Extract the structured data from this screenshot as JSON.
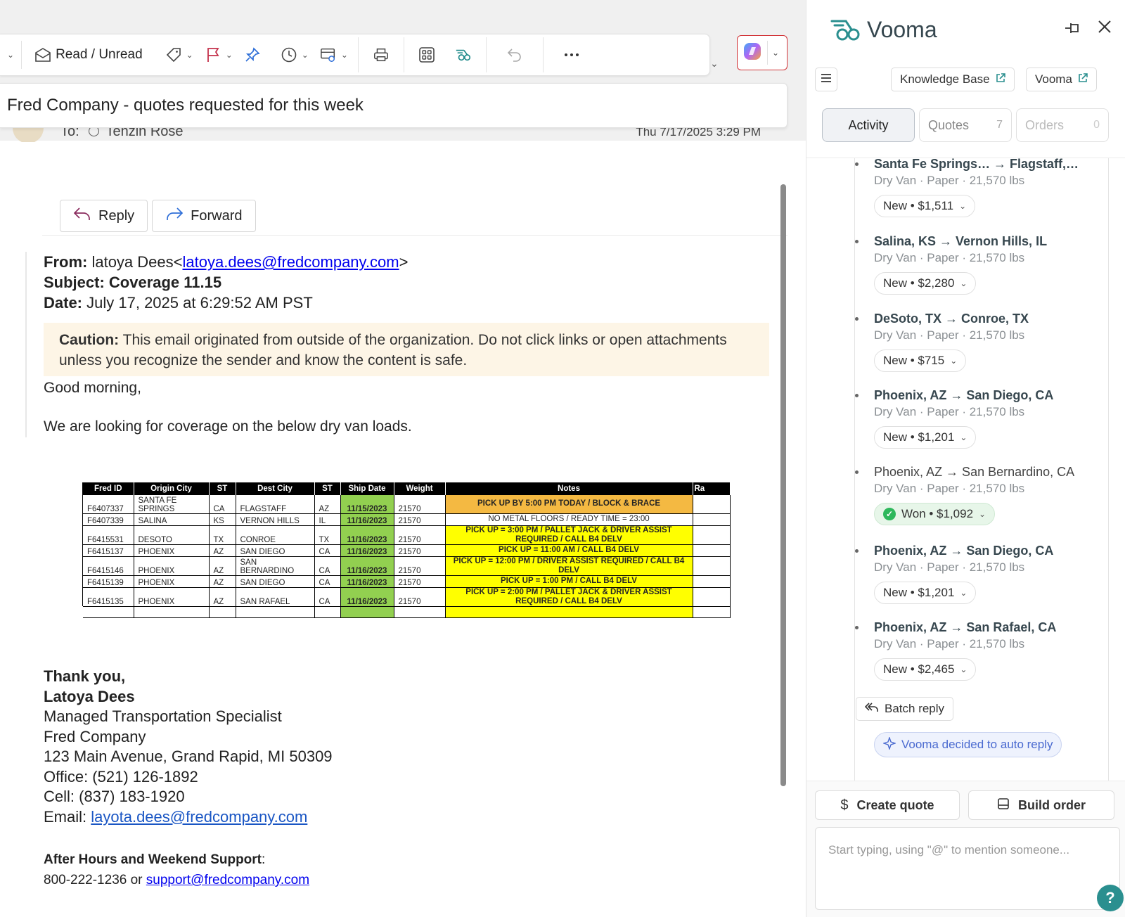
{
  "toolbar": {
    "read_unread_label": "Read / Unread"
  },
  "email": {
    "subject_bar": "Fred Company - quotes requested for this week",
    "to_prefix": "To:",
    "to_name": "Tenzin Rose",
    "date_received": "Thu 7/17/2025 3:29 PM",
    "reply_label": "Reply",
    "forward_label": "Forward",
    "from_label": "From:",
    "from_name": "latoya Dees",
    "from_email": "latoya.dees@fredcompany.com",
    "subject_line": "Subject: Coverage 11.15",
    "date_label": "Date:",
    "date_value": "July 17, 2025 at 6:29:52 AM PST",
    "caution_label": "Caution:",
    "caution_text": "This email originated from outside of the organization. Do not click links or open attachments unless you recognize the sender and know the content is safe.",
    "greeting": "Good morning,",
    "intro": "We are looking for coverage on the below dry van loads.",
    "table": {
      "headers": [
        "Fred ID",
        "Origin City",
        "ST",
        "Dest City",
        "ST",
        "Ship Date",
        "Weight",
        "Notes",
        "Ra"
      ],
      "rows": [
        {
          "id": "F6407337",
          "origin": "SANTA FE SPRINGS",
          "ost": "CA",
          "dest": "FLAGSTAFF",
          "dst": "AZ",
          "date": "11/15/2023",
          "weight": "21570",
          "notes": "PICK UP BY 5:00 PM TODAY / BLOCK & BRACE"
        },
        {
          "id": "F6407339",
          "origin": "SALINA",
          "ost": "KS",
          "dest": "VERNON HILLS",
          "dst": "IL",
          "date": "11/16/2023",
          "weight": "21570",
          "notes": "NO METAL FLOORS / READY TIME = 23:00"
        },
        {
          "id": "F6415531",
          "origin": "DESOTO",
          "ost": "TX",
          "dest": "CONROE",
          "dst": "TX",
          "date": "11/16/2023",
          "weight": "21570",
          "notes": "PICK UP = 3:00 PM / PALLET JACK & DRIVER ASSIST REQUIRED / CALL B4 DELV"
        },
        {
          "id": "F6415137",
          "origin": "PHOENIX",
          "ost": "AZ",
          "dest": "SAN DIEGO",
          "dst": "CA",
          "date": "11/16/2023",
          "weight": "21570",
          "notes": "PICK UP = 11:00 AM / CALL B4 DELV"
        },
        {
          "id": "F6415146",
          "origin": "PHOENIX",
          "ost": "AZ",
          "dest": "SAN BERNARDINO",
          "dst": "CA",
          "date": "11/16/2023",
          "weight": "21570",
          "notes": "PICK UP = 12:00 PM / DRIVER ASSIST REQUIRED / CALL B4 DELV"
        },
        {
          "id": "F6415139",
          "origin": "PHOENIX",
          "ost": "AZ",
          "dest": "SAN DIEGO",
          "dst": "CA",
          "date": "11/16/2023",
          "weight": "21570",
          "notes": "PICK UP = 1:00 PM / CALL B4 DELV"
        },
        {
          "id": "F6415135",
          "origin": "PHOENIX",
          "ost": "AZ",
          "dest": "SAN RAFAEL",
          "dst": "CA",
          "date": "11/16/2023",
          "weight": "21570",
          "notes": "PICK UP = 2:00 PM / PALLET JACK & DRIVER ASSIST REQUIRED / CALL B4 DELV"
        }
      ]
    },
    "signature": {
      "thanks": "Thank you,",
      "name": "Latoya Dees",
      "role": "Managed Transportation Specialist",
      "company": "Fred Company",
      "address": "123 Main Avenue, Grand Rapid, MI 50309",
      "office": "Office: (521) 126-1892",
      "cell": "Cell: (837) 183-1920",
      "email_label": "Email:",
      "email": "layota.dees@fredcompany.com"
    },
    "support": {
      "label": "After Hours and Weekend Support",
      "colon": ":",
      "phone": "800-222-1236 or",
      "email": "support@fredcompany.com"
    }
  },
  "vooma": {
    "title": "Vooma",
    "knowledge_base_label": "Knowledge Base",
    "vooma_link_label": "Vooma",
    "tabs": [
      {
        "label": "Activity"
      },
      {
        "label": "Quotes",
        "count": "7"
      },
      {
        "label": "Orders",
        "count": "0"
      }
    ],
    "quotes": [
      {
        "route": "Santa Fe Springs… → Flagstaff,…",
        "meta": "Dry Van · Paper · 21,570 lbs",
        "status": "New • $1,511"
      },
      {
        "route": "Salina, KS → Vernon Hills, IL",
        "meta": "Dry Van · Paper · 21,570 lbs",
        "status": "New • $2,280"
      },
      {
        "route": "DeSoto, TX → Conroe, TX",
        "meta": "Dry Van · Paper · 21,570 lbs",
        "status": "New • $715"
      },
      {
        "route": "Phoenix, AZ → San Diego, CA",
        "meta": "Dry Van · Paper · 21,570 lbs",
        "status": "New • $1,201"
      },
      {
        "route": "Phoenix, AZ → San Bernardino, CA",
        "meta": "Dry Van · Paper · 21,570 lbs",
        "status": "Won • $1,092"
      },
      {
        "route": "Phoenix, AZ → San Diego, CA",
        "meta": "Dry Van · Paper · 21,570 lbs",
        "status": "New • $1,201"
      },
      {
        "route": "Phoenix, AZ → San Rafael, CA",
        "meta": "Dry Van · Paper · 21,570 lbs",
        "status": "New • $2,465"
      }
    ],
    "batch_reply_label": "Batch reply",
    "auto_reply_label": "Vooma decided to auto reply",
    "create_quote_label": "Create quote",
    "build_order_label": "Build order",
    "input_placeholder": "Start typing, using \"@\" to mention someone...",
    "help_label": "?"
  },
  "colors": {
    "accent_teal": "#2a8f8f",
    "won_green": "#2eb85c",
    "date_green": "#92d050",
    "note_yellow": "#ffff00",
    "note_orange": "#f4b942"
  }
}
